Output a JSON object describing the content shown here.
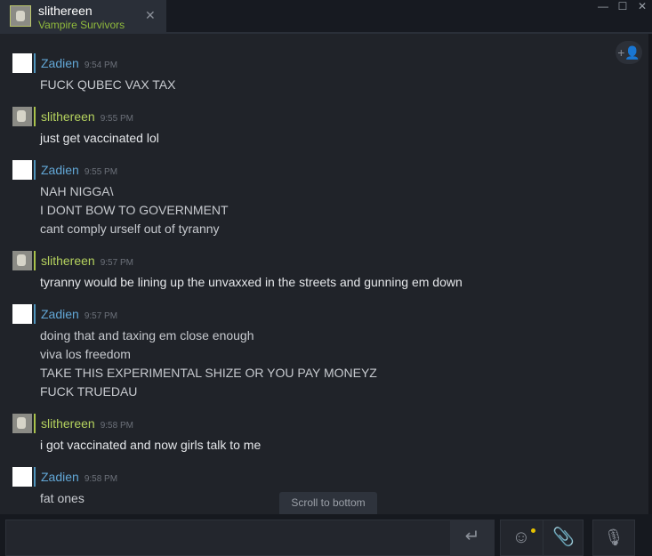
{
  "tab": {
    "name": "slithereen",
    "game": "Vampire Survivors",
    "close": "✕"
  },
  "window": {
    "minimize": "—",
    "maximize": "☐",
    "close": "✕"
  },
  "chat": {
    "add_user_icon": "+👤",
    "messages": [
      {
        "author": "Zadien",
        "time": "9:54 PM",
        "lines": [
          "FUCK QUBEC VAX TAX"
        ]
      },
      {
        "author": "slithereen",
        "time": "9:55 PM",
        "lines": [
          "just get vaccinated lol"
        ]
      },
      {
        "author": "Zadien",
        "time": "9:55 PM",
        "lines": [
          "NAH NIGGA\\",
          "I DONT BOW TO GOVERNMENT",
          "cant comply urself out of tyranny"
        ]
      },
      {
        "author": "slithereen",
        "time": "9:57 PM",
        "lines": [
          "tyranny would be lining up the unvaxxed in the streets and gunning em down"
        ]
      },
      {
        "author": "Zadien",
        "time": "9:57 PM",
        "lines": [
          "doing that and taxing em close enough",
          "viva los freedom",
          "TAKE THIS EXPERIMENTAL SHIZE OR YOU PAY MONEYZ",
          "FUCK TRUEDAU"
        ]
      },
      {
        "author": "slithereen",
        "time": "9:58 PM",
        "lines": [
          "i got vaccinated and now girls talk to me"
        ]
      },
      {
        "author": "Zadien",
        "time": "9:58 PM",
        "lines": [
          "fat ones"
        ]
      }
    ],
    "scroll_to_bottom": "Scroll to bottom"
  },
  "footer": {
    "input_value": "",
    "send_icon": "↵",
    "emoji_icon": "☺",
    "attach_icon": "📎",
    "voice_icon": "🎙"
  }
}
